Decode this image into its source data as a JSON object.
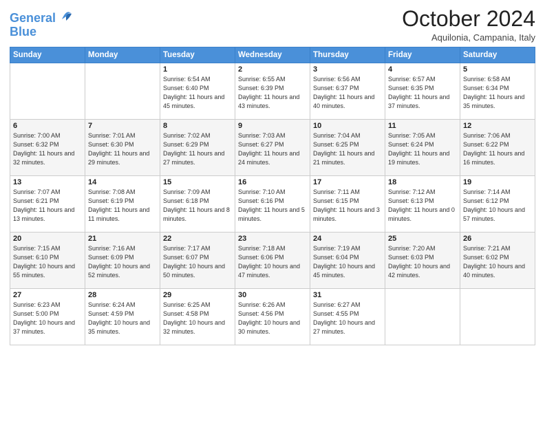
{
  "header": {
    "logo_line1": "General",
    "logo_line2": "Blue",
    "month": "October 2024",
    "location": "Aquilonia, Campania, Italy"
  },
  "weekdays": [
    "Sunday",
    "Monday",
    "Tuesday",
    "Wednesday",
    "Thursday",
    "Friday",
    "Saturday"
  ],
  "weeks": [
    [
      {
        "day": "",
        "info": ""
      },
      {
        "day": "",
        "info": ""
      },
      {
        "day": "1",
        "info": "Sunrise: 6:54 AM\nSunset: 6:40 PM\nDaylight: 11 hours and 45 minutes."
      },
      {
        "day": "2",
        "info": "Sunrise: 6:55 AM\nSunset: 6:39 PM\nDaylight: 11 hours and 43 minutes."
      },
      {
        "day": "3",
        "info": "Sunrise: 6:56 AM\nSunset: 6:37 PM\nDaylight: 11 hours and 40 minutes."
      },
      {
        "day": "4",
        "info": "Sunrise: 6:57 AM\nSunset: 6:35 PM\nDaylight: 11 hours and 37 minutes."
      },
      {
        "day": "5",
        "info": "Sunrise: 6:58 AM\nSunset: 6:34 PM\nDaylight: 11 hours and 35 minutes."
      }
    ],
    [
      {
        "day": "6",
        "info": "Sunrise: 7:00 AM\nSunset: 6:32 PM\nDaylight: 11 hours and 32 minutes."
      },
      {
        "day": "7",
        "info": "Sunrise: 7:01 AM\nSunset: 6:30 PM\nDaylight: 11 hours and 29 minutes."
      },
      {
        "day": "8",
        "info": "Sunrise: 7:02 AM\nSunset: 6:29 PM\nDaylight: 11 hours and 27 minutes."
      },
      {
        "day": "9",
        "info": "Sunrise: 7:03 AM\nSunset: 6:27 PM\nDaylight: 11 hours and 24 minutes."
      },
      {
        "day": "10",
        "info": "Sunrise: 7:04 AM\nSunset: 6:25 PM\nDaylight: 11 hours and 21 minutes."
      },
      {
        "day": "11",
        "info": "Sunrise: 7:05 AM\nSunset: 6:24 PM\nDaylight: 11 hours and 19 minutes."
      },
      {
        "day": "12",
        "info": "Sunrise: 7:06 AM\nSunset: 6:22 PM\nDaylight: 11 hours and 16 minutes."
      }
    ],
    [
      {
        "day": "13",
        "info": "Sunrise: 7:07 AM\nSunset: 6:21 PM\nDaylight: 11 hours and 13 minutes."
      },
      {
        "day": "14",
        "info": "Sunrise: 7:08 AM\nSunset: 6:19 PM\nDaylight: 11 hours and 11 minutes."
      },
      {
        "day": "15",
        "info": "Sunrise: 7:09 AM\nSunset: 6:18 PM\nDaylight: 11 hours and 8 minutes."
      },
      {
        "day": "16",
        "info": "Sunrise: 7:10 AM\nSunset: 6:16 PM\nDaylight: 11 hours and 5 minutes."
      },
      {
        "day": "17",
        "info": "Sunrise: 7:11 AM\nSunset: 6:15 PM\nDaylight: 11 hours and 3 minutes."
      },
      {
        "day": "18",
        "info": "Sunrise: 7:12 AM\nSunset: 6:13 PM\nDaylight: 11 hours and 0 minutes."
      },
      {
        "day": "19",
        "info": "Sunrise: 7:14 AM\nSunset: 6:12 PM\nDaylight: 10 hours and 57 minutes."
      }
    ],
    [
      {
        "day": "20",
        "info": "Sunrise: 7:15 AM\nSunset: 6:10 PM\nDaylight: 10 hours and 55 minutes."
      },
      {
        "day": "21",
        "info": "Sunrise: 7:16 AM\nSunset: 6:09 PM\nDaylight: 10 hours and 52 minutes."
      },
      {
        "day": "22",
        "info": "Sunrise: 7:17 AM\nSunset: 6:07 PM\nDaylight: 10 hours and 50 minutes."
      },
      {
        "day": "23",
        "info": "Sunrise: 7:18 AM\nSunset: 6:06 PM\nDaylight: 10 hours and 47 minutes."
      },
      {
        "day": "24",
        "info": "Sunrise: 7:19 AM\nSunset: 6:04 PM\nDaylight: 10 hours and 45 minutes."
      },
      {
        "day": "25",
        "info": "Sunrise: 7:20 AM\nSunset: 6:03 PM\nDaylight: 10 hours and 42 minutes."
      },
      {
        "day": "26",
        "info": "Sunrise: 7:21 AM\nSunset: 6:02 PM\nDaylight: 10 hours and 40 minutes."
      }
    ],
    [
      {
        "day": "27",
        "info": "Sunrise: 6:23 AM\nSunset: 5:00 PM\nDaylight: 10 hours and 37 minutes."
      },
      {
        "day": "28",
        "info": "Sunrise: 6:24 AM\nSunset: 4:59 PM\nDaylight: 10 hours and 35 minutes."
      },
      {
        "day": "29",
        "info": "Sunrise: 6:25 AM\nSunset: 4:58 PM\nDaylight: 10 hours and 32 minutes."
      },
      {
        "day": "30",
        "info": "Sunrise: 6:26 AM\nSunset: 4:56 PM\nDaylight: 10 hours and 30 minutes."
      },
      {
        "day": "31",
        "info": "Sunrise: 6:27 AM\nSunset: 4:55 PM\nDaylight: 10 hours and 27 minutes."
      },
      {
        "day": "",
        "info": ""
      },
      {
        "day": "",
        "info": ""
      }
    ]
  ]
}
